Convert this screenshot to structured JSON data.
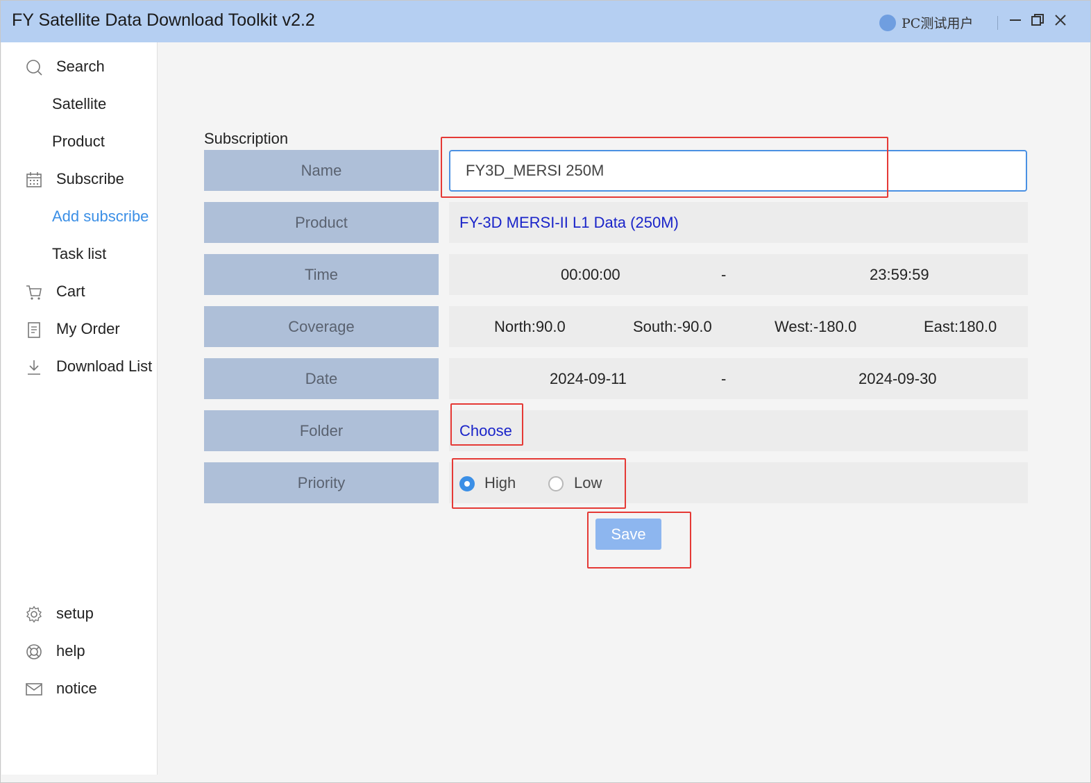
{
  "window": {
    "title": "FY Satellite Data Download Toolkit v2.2",
    "user_name": "PC测试用户",
    "controls": {
      "minimize": "—",
      "maximize": "❐",
      "close": "✕"
    }
  },
  "sidebar": {
    "items": [
      {
        "label": "Search",
        "icon": "search-icon"
      },
      {
        "label": "Satellite"
      },
      {
        "label": "Product"
      },
      {
        "label": "Subscribe",
        "icon": "calendar-icon"
      },
      {
        "label": "Add subscribe",
        "active": true
      },
      {
        "label": "Task list"
      },
      {
        "label": "Cart",
        "icon": "cart-icon"
      },
      {
        "label": "My Order",
        "icon": "document-icon"
      },
      {
        "label": "Download List",
        "icon": "download-icon"
      }
    ],
    "bottom_items": [
      {
        "label": "setup",
        "icon": "gear-icon"
      },
      {
        "label": "help",
        "icon": "lifebuoy-icon"
      },
      {
        "label": "notice",
        "icon": "mail-icon"
      }
    ]
  },
  "form": {
    "title": "Subscription",
    "labels": {
      "name": "Name",
      "product": "Product",
      "time": "Time",
      "coverage": "Coverage",
      "date": "Date",
      "folder": "Folder",
      "priority": "Priority"
    },
    "name_value": "FY3D_MERSI 250M",
    "product_value": "FY-3D MERSI-II L1 Data (250M)",
    "time": {
      "start": "00:00:00",
      "separator": "-",
      "end": "23:59:59"
    },
    "coverage": {
      "north": "North:90.0",
      "south": "South:-90.0",
      "west": "West:-180.0",
      "east": "East:180.0"
    },
    "date": {
      "start": "2024-09-11",
      "separator": "-",
      "end": "2024-09-30"
    },
    "folder_link": "Choose",
    "priority": {
      "options": [
        "High",
        "Low"
      ],
      "selected": "High"
    },
    "save_label": "Save"
  },
  "colors": {
    "titlebar": "#b5cff2",
    "label_bg": "#aebfd8",
    "accent": "#3b8fe6",
    "link": "#1a24c9",
    "save_button": "#8db6ef",
    "annotation": "#e53935"
  }
}
